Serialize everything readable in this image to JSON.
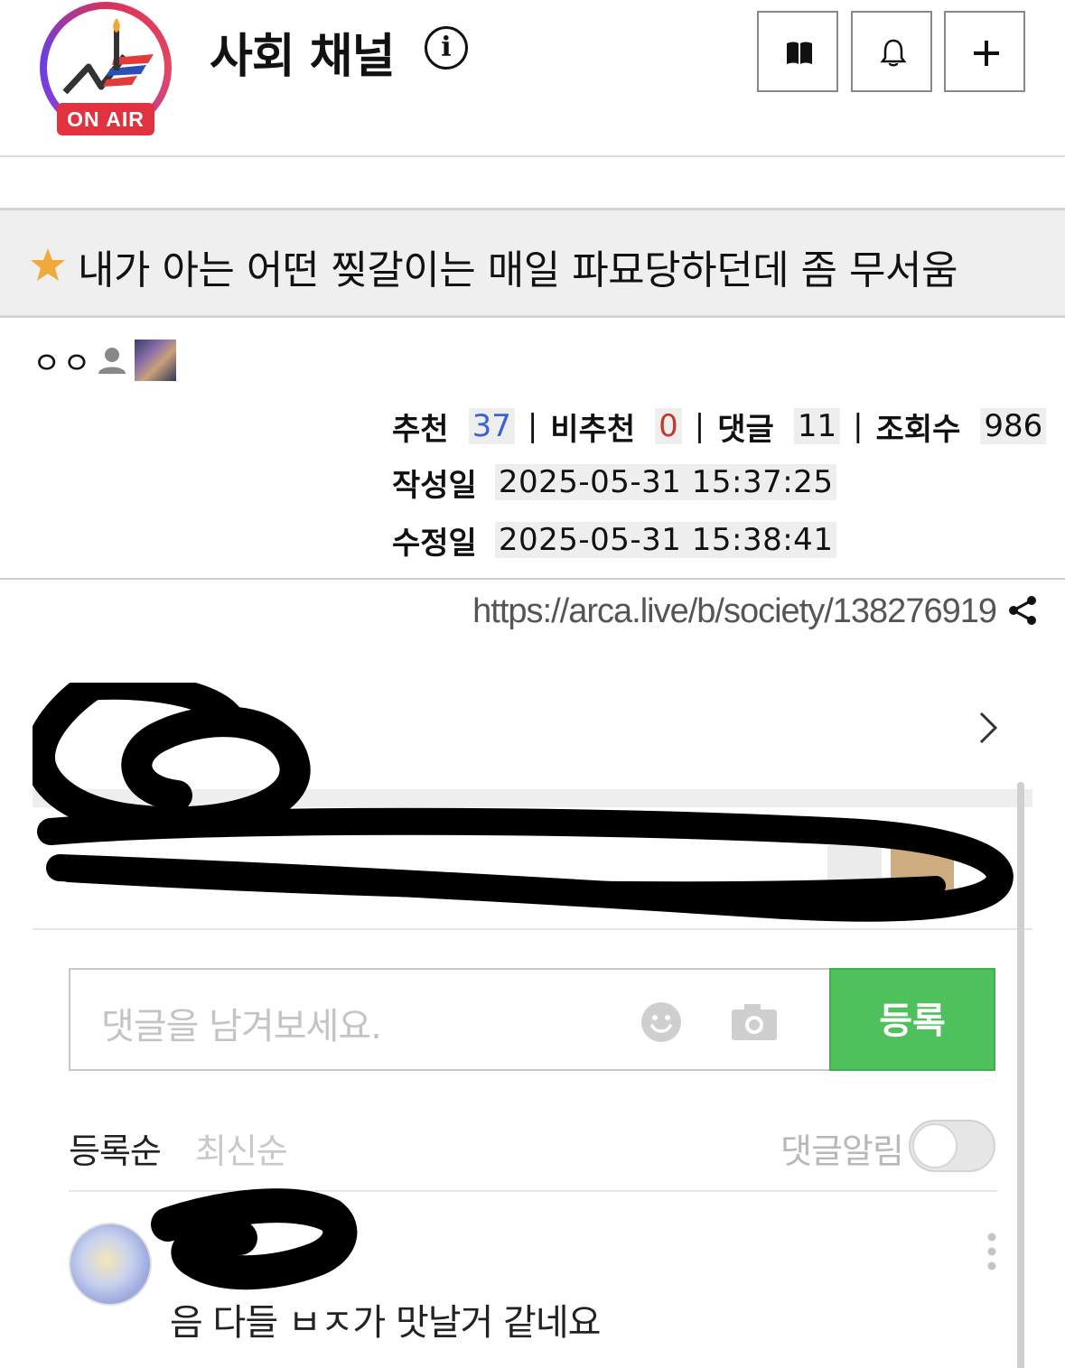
{
  "channel": {
    "title": "사회 채널",
    "badge": "ON AIR",
    "badge_color": "#e0333f",
    "info_icon": "info-icon",
    "actions": [
      {
        "icon": "book-icon"
      },
      {
        "icon": "bell-icon"
      },
      {
        "icon": "plus-icon"
      }
    ]
  },
  "post": {
    "star_icon": "star-icon",
    "star_color": "#f0a93b",
    "title": "내가 아는 어떤 찢갈이는 매일 파묘당하던데 좀 무서움",
    "author": "ㅇㅇ",
    "stats": {
      "recommend_label": "추천",
      "recommend": "37",
      "downvote_label": "비추천",
      "downvote": "0",
      "comments_label": "댓글",
      "comments": "11",
      "views_label": "조회수",
      "views": "986",
      "separator": "|"
    },
    "created_label": "작성일",
    "created": "2025-05-31 15:37:25",
    "modified_label": "수정일",
    "modified": "2025-05-31 15:38:41",
    "url": "https://arca.live/b/society/138276919"
  },
  "embedded": {
    "comment_placeholder": "댓글을 남겨보세요.",
    "submit_label": "등록",
    "submit_color": "#4fc15c",
    "sort_registered": "등록순",
    "sort_latest": "최신순",
    "notify_label": "댓글알림",
    "notify_on": false,
    "comment_text": "음 다들 ㅂㅈ가 맛날거 같네요"
  }
}
